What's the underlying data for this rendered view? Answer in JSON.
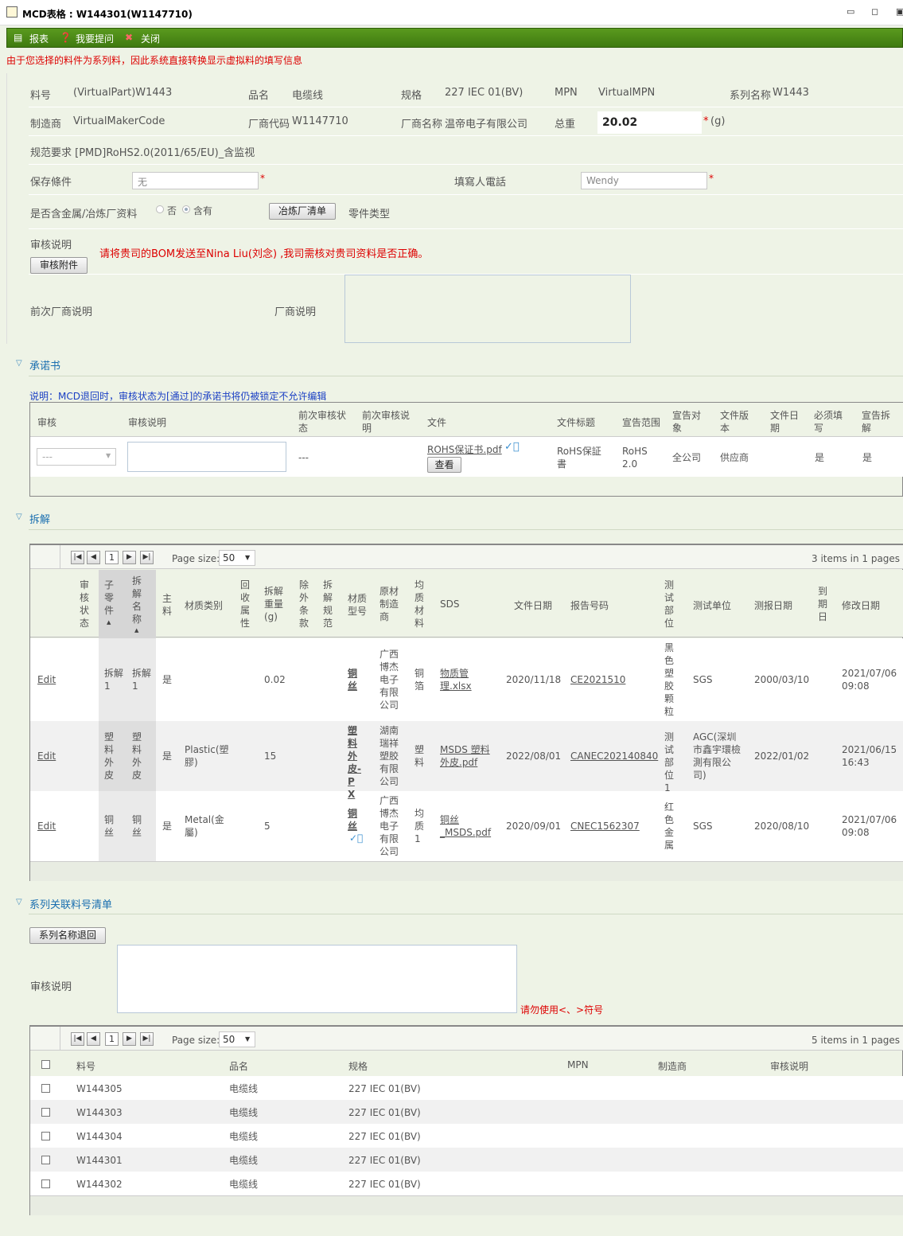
{
  "window": {
    "title": "MCD表格 : W144301(W1147710)"
  },
  "toolbar": {
    "report": "报表",
    "ask": "我要提问",
    "close": "关闭"
  },
  "notice": "由于您选择的料件为系列料，因此系统直接转换显示虚拟料的填写信息",
  "form": {
    "part_no_label": "料号",
    "part_no": "(VirtualPart)W1443",
    "name_label": "品名",
    "name": "电缆线",
    "spec_label": "规格",
    "spec": "227 IEC 01(BV)",
    "mpn_label": "MPN",
    "mpn": "VirtualMPN",
    "series_label": "系列名称",
    "series": "W1443",
    "maker_label": "制造商",
    "maker": "VirtualMakerCode",
    "vendor_code_label": "厂商代码",
    "vendor_code": "W1147710",
    "vendor_name_label": "厂商名称",
    "vendor_name": "温帝电子有限公司",
    "weight_label": "总重",
    "weight": "20.02",
    "weight_unit": "(g)",
    "spec_req": "规范要求 [PMD]RoHS2.0(2011/65/EU)_含监视",
    "storage_label": "保存條件",
    "storage": "无",
    "phone_label": "填寫人電話",
    "phone": "Wendy",
    "metal_label": "是否含金属/冶炼厂资料",
    "opt_no": "否",
    "opt_yes": "含有",
    "smelter_btn": "冶炼厂清单",
    "part_type_label": "零件类型",
    "audit_label": "审核说明",
    "audit_attach_btn": "审核附件",
    "audit_msg": "请将贵司的BOM发送至Nina Liu(刘念) ,我司需核对贵司资料是否正确。",
    "prev_vendor_label": "前次厂商说明",
    "vendor_note_label": "厂商说明"
  },
  "commit": {
    "title": "承诺书",
    "note": "说明：MCD退回时，审核状态为[通过]的承诺书将仍被锁定不允许编辑",
    "headers": [
      "审核",
      "审核说明",
      "前次审核状态",
      "前次审核说明",
      "文件",
      "文件标题",
      "宣告范围",
      "宣告对象",
      "文件版本",
      "文件日期",
      "必须填写",
      "宣告拆解"
    ],
    "row": {
      "audit": "---",
      "prev_status": "---",
      "file": "ROHS保证书.pdf",
      "view_btn": "查看",
      "file_title": "RoHS保証書",
      "scope": "RoHS 2.0",
      "target": "全公司",
      "version": "供应商",
      "date": "",
      "required": "是",
      "disassembly": "是"
    }
  },
  "disassembly": {
    "title": "拆解",
    "page": "1",
    "page_size_label": "Page size:",
    "page_size": "50",
    "items": "3 items in 1 pages",
    "headers": [
      "审核状态",
      "子零件",
      "拆解名称",
      "主料",
      "材质类别",
      "回收属性",
      "拆解重量(g)",
      "除外条款",
      "拆解规范",
      "材质型号",
      "原材制造商",
      "均质材料",
      "SDS",
      "文件日期",
      "报告号码",
      "测试部位",
      "测试单位",
      "测报日期",
      "到期日",
      "修改日期"
    ],
    "rows": [
      {
        "edit": "Edit",
        "sub": "拆解1",
        "name": "拆解1",
        "main": "是",
        "mat": "",
        "weight": "0.02",
        "model": "铜丝",
        "mfr": "广西博杰电子有限公司",
        "homog": "铜箔",
        "sds": "物质管理.xlsx",
        "fdate": "2020/11/18",
        "report": "CE2021510",
        "part": "黑色塑胶颗粒",
        "lab": "SGS",
        "tdate": "2000/03/10",
        "mdate": "2021/07/06 09:08"
      },
      {
        "edit": "Edit",
        "sub": "塑料外皮",
        "name": "塑料外皮",
        "main": "是",
        "mat": "Plastic(塑膠)",
        "weight": "15",
        "model": "塑料外皮-PX",
        "mfr": "湖南瑞祥塑胶有限公司",
        "homog": "塑料",
        "sds": "MSDS 塑料外皮.pdf",
        "fdate": "2022/08/01",
        "report": "CANEC202140840",
        "part": "测试部位1",
        "lab": "AGC(深圳市鑫宇環檢測有限公司)",
        "tdate": "2022/01/02",
        "mdate": "2021/06/15 16:43"
      },
      {
        "edit": "Edit",
        "sub": "铜丝",
        "name": "铜丝",
        "main": "是",
        "mat": "Metal(金屬)",
        "weight": "5",
        "model": "铜丝",
        "mfr": "广西博杰电子有限公司",
        "homog": "均质1",
        "sds": "铜丝 _MSDS.pdf",
        "fdate": "2020/09/01",
        "report": "CNEC1562307",
        "part": "红色金属",
        "lab": "SGS",
        "tdate": "2020/08/10",
        "mdate": "2021/07/06 09:08"
      }
    ]
  },
  "series_list": {
    "title": "系列关联料号清单",
    "return_btn": "系列名称退回",
    "audit_label": "审核说明",
    "warn": "请勿使用<、>符号",
    "page": "1",
    "page_size_label": "Page size:",
    "page_size": "50",
    "items": "5 items in 1 pages",
    "headers": [
      "料号",
      "品名",
      "规格",
      "MPN",
      "制造商",
      "审核说明"
    ],
    "rows": [
      {
        "part": "W144305",
        "name": "电缆线",
        "spec": "227 IEC 01(BV)"
      },
      {
        "part": "W144303",
        "name": "电缆线",
        "spec": "227 IEC 01(BV)"
      },
      {
        "part": "W144304",
        "name": "电缆线",
        "spec": "227 IEC 01(BV)"
      },
      {
        "part": "W144301",
        "name": "电缆线",
        "spec": "227 IEC 01(BV)"
      },
      {
        "part": "W144302",
        "name": "电缆线",
        "spec": "227 IEC 01(BV)"
      }
    ]
  }
}
